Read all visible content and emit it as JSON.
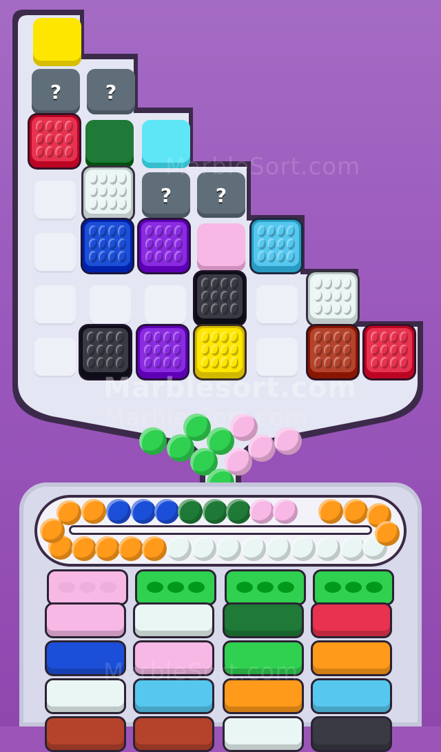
{
  "game": {
    "watermarks": [
      "Marblesort.com",
      "MarbleSort.com",
      "Marble Sort.com",
      "MarbleSort.com"
    ],
    "mystery_symbol": "?",
    "colors": {
      "background": "#9b55b8",
      "board": "#e4e6f3",
      "yellow": "#ffe600",
      "red": "#e8324f",
      "green_dark": "#1e7a36",
      "cyan": "#5ee6f6",
      "white": "#eaf6f4",
      "blue": "#1c4fd8",
      "purple": "#8a2be2",
      "pink": "#f7b8e6",
      "sky": "#56c8f0",
      "black": "#3a3a44",
      "brown": "#b5432c",
      "orange": "#ff9a1a",
      "green": "#30d050"
    },
    "board_blocks": [
      {
        "color": "yellow",
        "kind": "small"
      },
      {
        "color": "mystery",
        "kind": "mystery"
      },
      {
        "color": "mystery",
        "kind": "mystery"
      },
      {
        "color": "red",
        "kind": "studded"
      },
      {
        "color": "green_dark",
        "kind": "small"
      },
      {
        "color": "cyan",
        "kind": "small"
      },
      {
        "color": "white",
        "kind": "studded"
      },
      {
        "color": "mystery",
        "kind": "mystery"
      },
      {
        "color": "mystery",
        "kind": "mystery"
      },
      {
        "color": "blue",
        "kind": "studded"
      },
      {
        "color": "purple",
        "kind": "studded"
      },
      {
        "color": "pink",
        "kind": "small"
      },
      {
        "color": "sky",
        "kind": "studded"
      },
      {
        "color": "black",
        "kind": "studded"
      },
      {
        "color": "white",
        "kind": "studded"
      },
      {
        "color": "black",
        "kind": "studded"
      },
      {
        "color": "purple",
        "kind": "studded"
      },
      {
        "color": "yellow",
        "kind": "studded"
      },
      {
        "color": "brown",
        "kind": "studded"
      },
      {
        "color": "red",
        "kind": "studded"
      }
    ],
    "falling_marbles": [
      "green",
      "green",
      "green",
      "green",
      "green",
      "green",
      "pink",
      "pink",
      "pink",
      "pink",
      "pink"
    ],
    "conveyor_top": [
      "orange",
      "orange",
      "blue",
      "blue",
      "blue",
      "green_dark",
      "green_dark",
      "green_dark",
      "pink",
      "pink",
      "orange",
      "orange",
      "orange"
    ],
    "conveyor_bottom": [
      "orange",
      "orange",
      "orange",
      "orange",
      "orange",
      "white",
      "white",
      "white",
      "white",
      "white",
      "white",
      "white",
      "white",
      "white"
    ],
    "sort_columns": [
      {
        "head": "pink",
        "slabs": [
          "pink",
          "blue",
          "white",
          "brown"
        ]
      },
      {
        "head": "green",
        "slabs": [
          "white",
          "pink",
          "sky",
          "brown"
        ]
      },
      {
        "head": "green",
        "slabs": [
          "green_dark",
          "green",
          "orange",
          "white"
        ]
      },
      {
        "head": "green",
        "slabs": [
          "red",
          "orange",
          "sky",
          "black"
        ]
      }
    ]
  }
}
